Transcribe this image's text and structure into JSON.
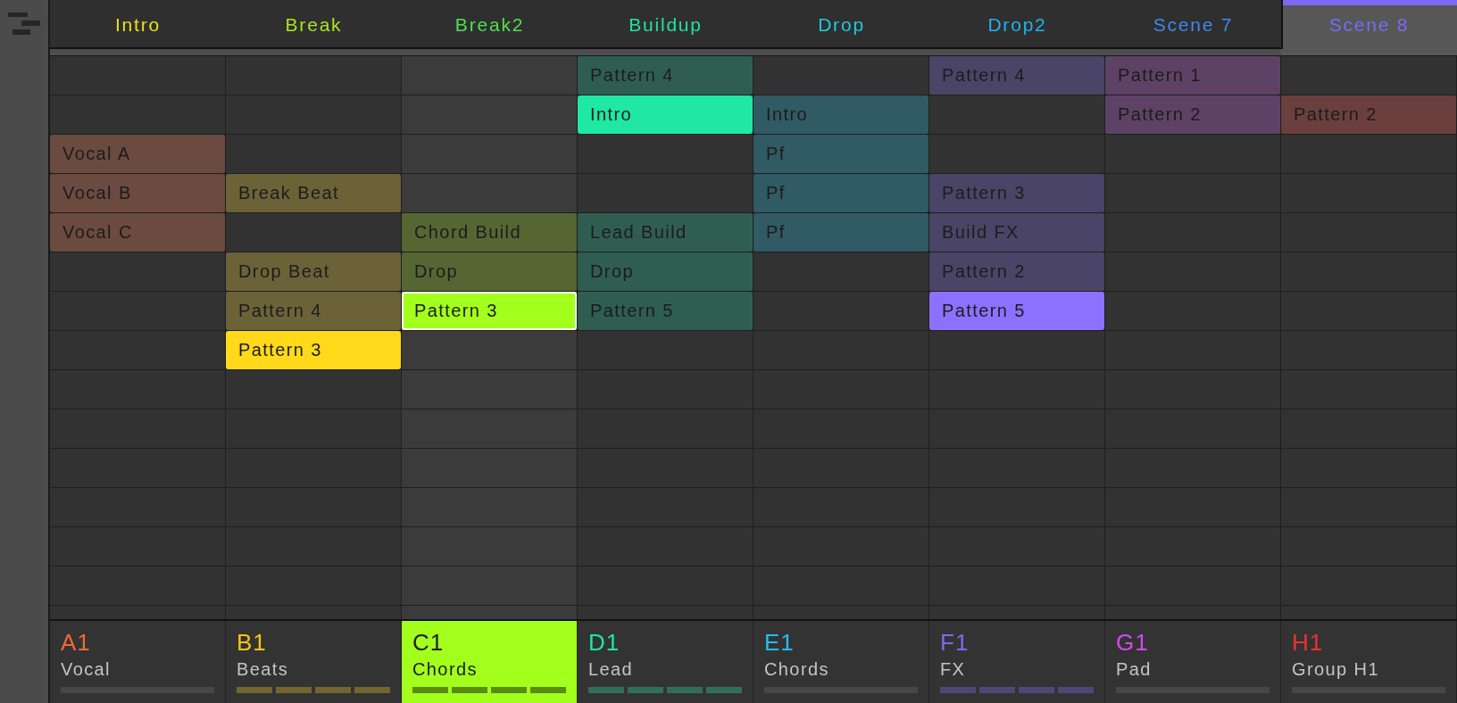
{
  "scenes": [
    {
      "label": "Intro",
      "color": "#e6e21e",
      "selected": false
    },
    {
      "label": "Break",
      "color": "#a8e61e",
      "selected": false
    },
    {
      "label": "Break2",
      "color": "#4fe04f",
      "selected": false
    },
    {
      "label": "Buildup",
      "color": "#20e0a2",
      "selected": false
    },
    {
      "label": "Drop",
      "color": "#20c8e0",
      "selected": false
    },
    {
      "label": "Drop2",
      "color": "#20b2ef",
      "selected": false
    },
    {
      "label": "Scene 7",
      "color": "#4088f0",
      "selected": false
    },
    {
      "label": "Scene 8",
      "color": "#7a6af6",
      "selected": true
    }
  ],
  "pattern_grid": {
    "rows": [
      [
        null,
        null,
        null,
        {
          "label": "Pattern 4",
          "color": "#2f5e50",
          "selected": false
        },
        null,
        {
          "label": "Pattern 4",
          "color": "#4a4566",
          "selected": false
        },
        {
          "label": "Pattern 1",
          "color": "#5e4266",
          "selected": false
        },
        null
      ],
      [
        null,
        null,
        null,
        {
          "label": "Intro",
          "color": "#1ee8a4",
          "selected": false
        },
        {
          "label": "Intro",
          "color": "#305a64",
          "selected": false
        },
        null,
        {
          "label": "Pattern 2",
          "color": "#5e4266",
          "selected": false
        },
        {
          "label": "Pattern 2",
          "color": "#6a3f3d",
          "selected": false
        }
      ],
      [
        {
          "label": "Vocal A",
          "color": "#6b4a40",
          "selected": false
        },
        null,
        null,
        null,
        {
          "label": "Pf",
          "color": "#305a64",
          "selected": false
        },
        null,
        null,
        null
      ],
      [
        {
          "label": "Vocal B",
          "color": "#6b4a40",
          "selected": false
        },
        {
          "label": "Break Beat",
          "color": "#6b6238",
          "selected": false
        },
        null,
        null,
        {
          "label": "Pf",
          "color": "#305a64",
          "selected": false
        },
        {
          "label": "Pattern 3",
          "color": "#4a4566",
          "selected": false
        },
        null,
        null
      ],
      [
        {
          "label": "Vocal C",
          "color": "#6b4a40",
          "selected": false
        },
        null,
        {
          "label": "Chord Build",
          "color": "#556633",
          "selected": false
        },
        {
          "label": "Lead Build",
          "color": "#2f5e50",
          "selected": false
        },
        {
          "label": "Pf",
          "color": "#305a64",
          "selected": false
        },
        {
          "label": "Build FX",
          "color": "#4a4566",
          "selected": false
        },
        null,
        null
      ],
      [
        null,
        {
          "label": "Drop Beat",
          "color": "#6b6238",
          "selected": false
        },
        {
          "label": "Drop",
          "color": "#556633",
          "selected": false
        },
        {
          "label": "Drop",
          "color": "#2f5e50",
          "selected": false
        },
        null,
        {
          "label": "Pattern 2",
          "color": "#4a4566",
          "selected": false
        },
        null,
        null
      ],
      [
        null,
        {
          "label": "Pattern 4",
          "color": "#6b6238",
          "selected": false
        },
        {
          "label": "Pattern 3",
          "color": "#a3ff1c",
          "selected": true
        },
        {
          "label": "Pattern 5",
          "color": "#2f5e50",
          "selected": false
        },
        null,
        {
          "label": "Pattern 5",
          "color": "#8a72ff",
          "selected": false
        },
        null,
        null
      ],
      [
        null,
        {
          "label": "Pattern 3",
          "color": "#ffd91a",
          "selected": false
        },
        null,
        null,
        null,
        null,
        null,
        null
      ]
    ]
  },
  "groups": [
    {
      "code": "A1",
      "name": "Vocal",
      "color": "#f06a35",
      "selected": false,
      "playing": false
    },
    {
      "code": "B1",
      "name": "Beats",
      "color": "#f5c518",
      "selected": false,
      "playing": true
    },
    {
      "code": "C1",
      "name": "Chords",
      "color": "#a3ff1c",
      "selected": true,
      "playing": true
    },
    {
      "code": "D1",
      "name": "Lead",
      "color": "#1ee8a4",
      "selected": false,
      "playing": true
    },
    {
      "code": "E1",
      "name": "Chords",
      "color": "#1ec0f0",
      "selected": false,
      "playing": false
    },
    {
      "code": "F1",
      "name": "FX",
      "color": "#7a6af6",
      "selected": false,
      "playing": true
    },
    {
      "code": "G1",
      "name": "Pad",
      "color": "#d24af0",
      "selected": false,
      "playing": false
    },
    {
      "code": "H1",
      "name": "Group H1",
      "color": "#f03030",
      "selected": false,
      "playing": false
    }
  ]
}
